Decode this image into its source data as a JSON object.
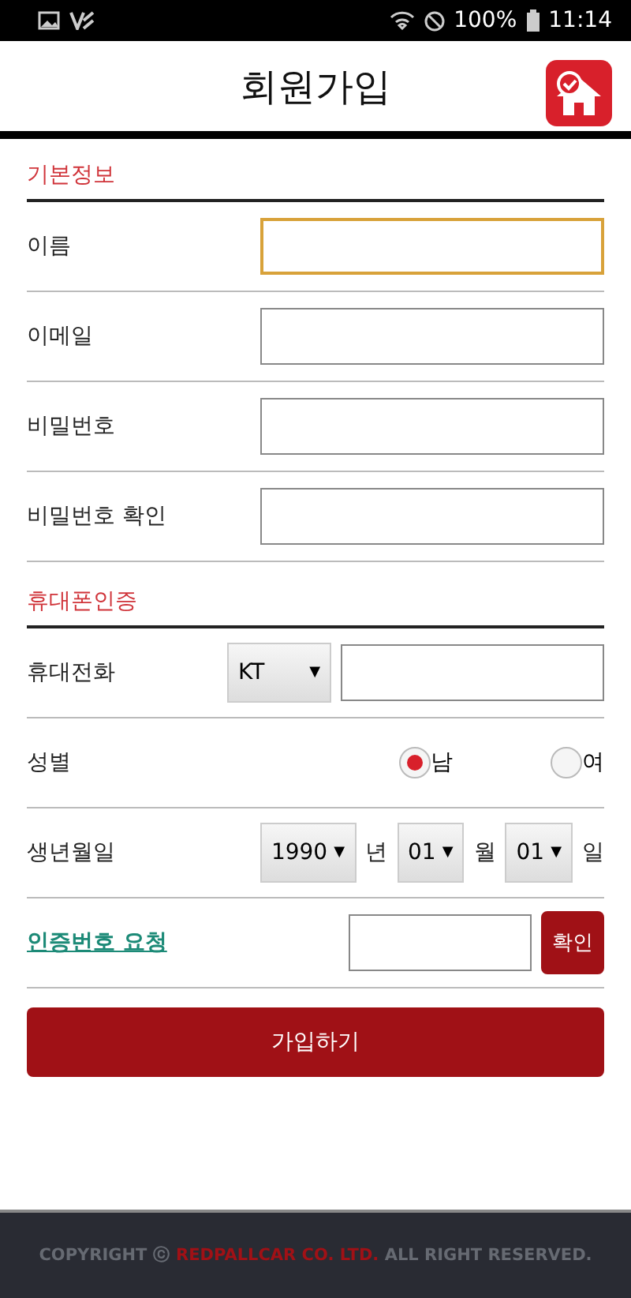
{
  "status_bar": {
    "battery": "100%",
    "time": "11:14"
  },
  "header": {
    "title": "회원가입"
  },
  "sections": [
    {
      "title": "기본정보",
      "rows": [
        {
          "kind": "text",
          "label": "이름",
          "focused": true
        },
        {
          "kind": "text",
          "label": "이메일",
          "focused": false
        },
        {
          "kind": "text",
          "label": "비밀번호",
          "focused": false
        },
        {
          "kind": "text",
          "label": "비밀번호 확인",
          "focused": false
        }
      ]
    },
    {
      "title": "휴대폰인증",
      "rows": [
        {
          "kind": "phone",
          "label": "휴대전화",
          "carrier": "KT",
          "carrier_arrow": "▼"
        },
        {
          "kind": "radio",
          "label": "성별",
          "options": [
            {
              "label": "남",
              "selected": true
            },
            {
              "label": "여",
              "selected": false
            }
          ]
        },
        {
          "kind": "date",
          "label": "생년월일",
          "parts": [
            {
              "value": "1990",
              "arrow": "▼",
              "unit": "년"
            },
            {
              "value": "01",
              "arrow": "▼",
              "unit": "월"
            },
            {
              "value": "01",
              "arrow": "▼",
              "unit": "일"
            }
          ]
        },
        {
          "kind": "verify",
          "link": "인증번호 요청",
          "button": "확인"
        }
      ]
    }
  ],
  "submit": "가입하기",
  "footer": {
    "prefix": "COPYRIGHT ⓒ",
    "company": "REDPALLCAR CO. LTD.",
    "suffix": "ALL RIGHT RESERVED."
  }
}
